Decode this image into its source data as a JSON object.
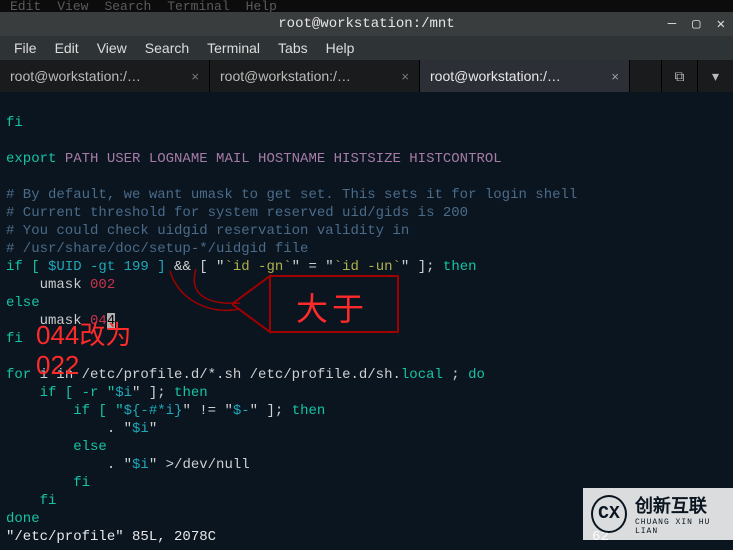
{
  "background_menu": [
    "Edit",
    "View",
    "Search",
    "Terminal",
    "Help"
  ],
  "window": {
    "title": "root@workstation:/mnt",
    "min_glyph": "—",
    "max_glyph": "▢",
    "close_glyph": "✕"
  },
  "menubar": [
    "File",
    "Edit",
    "View",
    "Search",
    "Terminal",
    "Tabs",
    "Help"
  ],
  "tabs": [
    {
      "label": "root@workstation:/…",
      "close": "×",
      "active": false
    },
    {
      "label": "root@workstation:/…",
      "close": "×",
      "active": false
    },
    {
      "label": "root@workstation:/…",
      "close": "×",
      "active": true
    }
  ],
  "newtab_icon": "⧉",
  "dropdown_icon": "▾",
  "code": {
    "l1": "fi",
    "l2": "",
    "l3_export": "export ",
    "l3_vars": "PATH USER LOGNAME MAIL HOSTNAME HISTSIZE HISTCONTROL",
    "l4": "",
    "c1": "# By default, we want umask to get set. This sets it for login shell",
    "c2": "# Current threshold for system reserved uid/gids is 200",
    "c3": "# You could check uidgid reservation validity in",
    "c4": "# /usr/share/doc/setup-*/uidgid file",
    "if_line_prefix": "if [ ",
    "uid_cond": "$UID -gt 199 ]",
    "if_mid": " && [ \"",
    "id_gn": "`id -gn`",
    "eq": "\" = \"",
    "id_un": "`id -un`",
    "if_tail": "\" ]; ",
    "then": "then",
    "umask002": "    umask ",
    "v002": "002",
    "else": "else",
    "umask044": "    umask ",
    "v04": "04",
    "v4": "4",
    "fi": "fi",
    "blank": "",
    "for_l": "for",
    "for_mid": " i in /etc/profile.d/*.sh /etc/profile.d/sh.",
    "local": "local",
    "semi_do": " ; ",
    "do": "do",
    "ifr": "    if [ -r \"",
    "var_i": "$i",
    "ifr_tail": "\" ]; ",
    "then2": "then",
    "nested_if": "        if [ \"",
    "exp_s": "${-#*i}",
    "ne": "\" != \"",
    "dash": "$-",
    "nested_tail": "\" ]; ",
    "then3": "then",
    "dot_line": "            . \"",
    "dot_tail": "\"",
    "else2": "        else",
    "null_line": "            . \"",
    "null_tail": "\" >/dev/null",
    "fi2": "        fi",
    "fi3": "    fi",
    "done": "done",
    "status": "\"/etc/profile\" 85L, 2078C",
    "status_col": "62"
  },
  "annotation": {
    "box_text": "大于",
    "replace_text": "044改为\n022"
  },
  "watermark": {
    "logo_letter": "CX",
    "cn": "创新互联",
    "en": "CHUANG XIN HU LIAN"
  }
}
